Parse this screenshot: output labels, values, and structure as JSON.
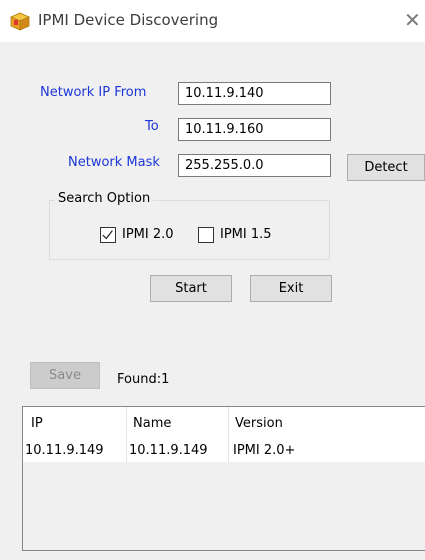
{
  "window": {
    "title": "IPMI Device Discovering",
    "close_glyph": "✕"
  },
  "form": {
    "network_ip_from_label": "Network IP  From",
    "from_value": "10.11.9.140",
    "to_label": "To",
    "to_value": "10.11.9.160",
    "network_mask_label": "Network Mask",
    "mask_value": "255.255.0.0",
    "detect_label": "Detect"
  },
  "search_option": {
    "title": "Search Option",
    "options": [
      {
        "label": "IPMI 2.0",
        "checked": true
      },
      {
        "label": "IPMI 1.5",
        "checked": false
      }
    ]
  },
  "actions": {
    "start_label": "Start",
    "exit_label": "Exit",
    "save_label": "Save",
    "save_enabled": false
  },
  "found_text": "Found:1",
  "table": {
    "columns": [
      "IP",
      "Name",
      "Version"
    ],
    "rows": [
      [
        "10.11.9.149",
        "10.11.9.149",
        "IPMI 2.0+"
      ]
    ]
  },
  "colors": {
    "label_blue": "#1c36d6",
    "window_bg": "#f0f0f0"
  },
  "icons": {
    "app": "package-icon",
    "close": "close-icon",
    "check": "checkmark-icon"
  }
}
